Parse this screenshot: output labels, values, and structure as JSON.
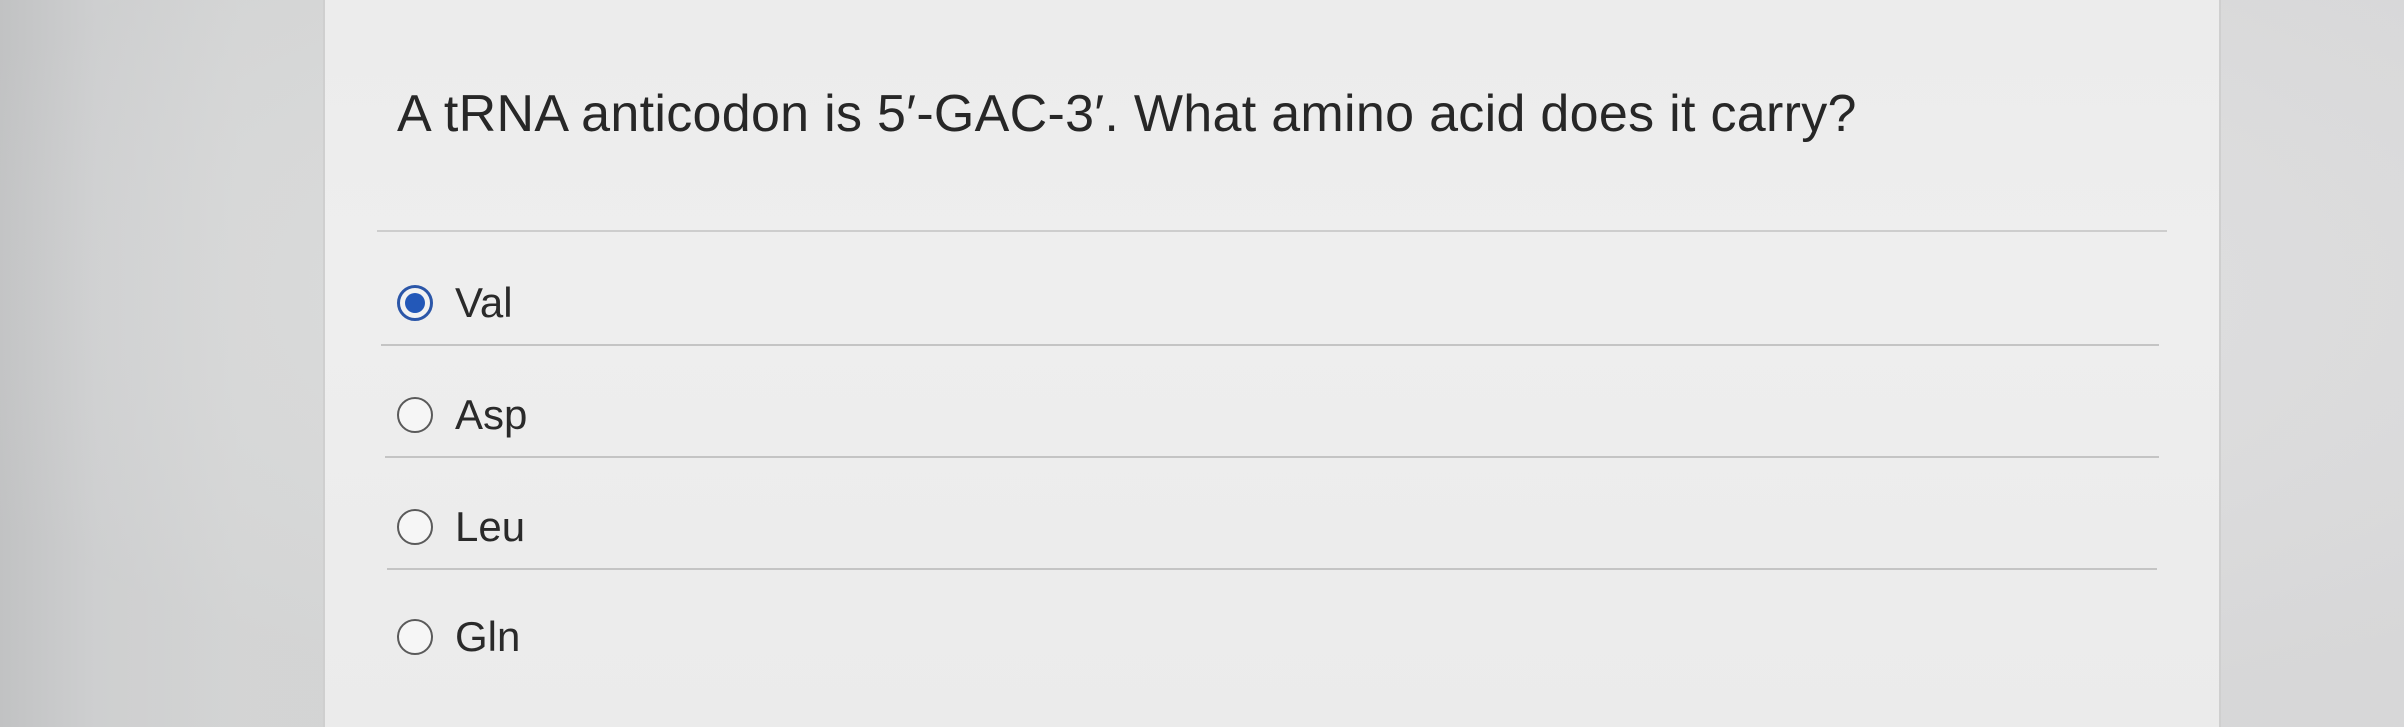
{
  "question": {
    "text": "A tRNA anticodon is 5′-GAC-3′. What amino acid does it carry?"
  },
  "options": [
    {
      "label": "Val",
      "selected": true
    },
    {
      "label": "Asp",
      "selected": false
    },
    {
      "label": "Leu",
      "selected": false
    },
    {
      "label": "Gln",
      "selected": false
    }
  ],
  "colors": {
    "accent": "#2358b8",
    "text": "#272727",
    "card": "#ececec"
  }
}
